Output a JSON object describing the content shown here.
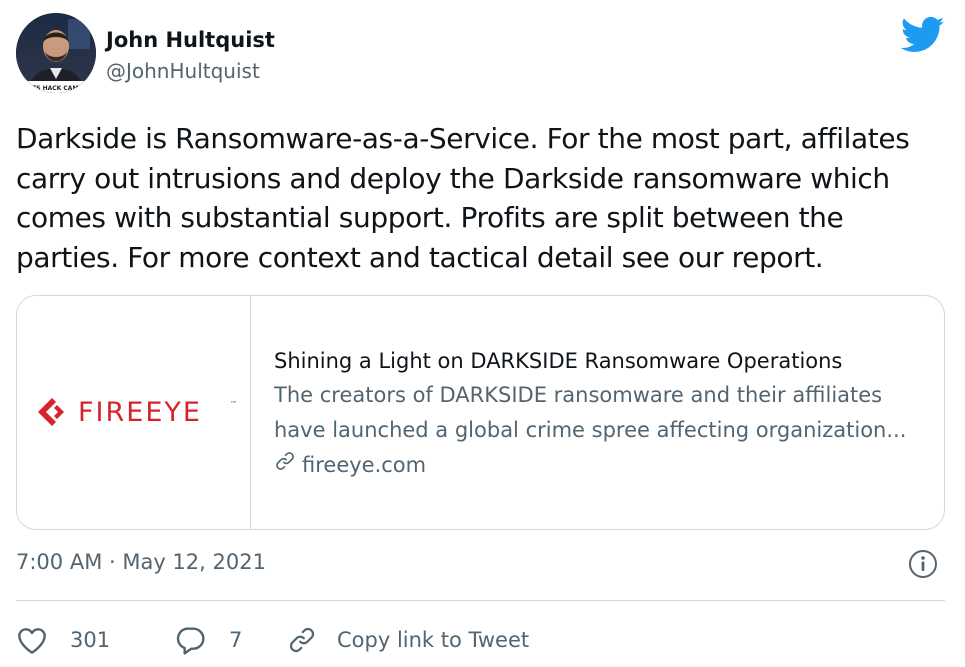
{
  "author": {
    "name": "John Hultquist",
    "handle": "@JohnHultquist",
    "avatar_caption": "ETS HACK CAME"
  },
  "tweet": {
    "text": "Darkside is Ransomware-as-a-Service. For the most part, affilates carry out intrusions and deploy the Darkside ransomware which comes with substantial support. Profits are split between the parties. For more context and tactical detail see our report.",
    "timestamp": "7:00 AM · May 12, 2021"
  },
  "card": {
    "logo_text": "FIREEYE",
    "logo_tm": "™",
    "title": "Shining a Light on DARKSIDE Ransomware Operations",
    "description": "The creators of DARKSIDE ransomware and their affiliates have launched a global crime spree affecting organization...",
    "domain": "fireeye.com"
  },
  "actions": {
    "like_count": "301",
    "reply_count": "7",
    "copy_link_label": "Copy link to Tweet"
  },
  "icons": {
    "brand": "twitter-bird-icon",
    "info": "info-icon",
    "like": "heart-icon",
    "reply": "reply-bubble-icon",
    "link": "link-icon"
  },
  "colors": {
    "brand_blue": "#1d9bf0",
    "text_primary": "#0f1419",
    "text_secondary": "#536471",
    "border": "#cfd9de",
    "fireeye_red": "#d6232d"
  }
}
